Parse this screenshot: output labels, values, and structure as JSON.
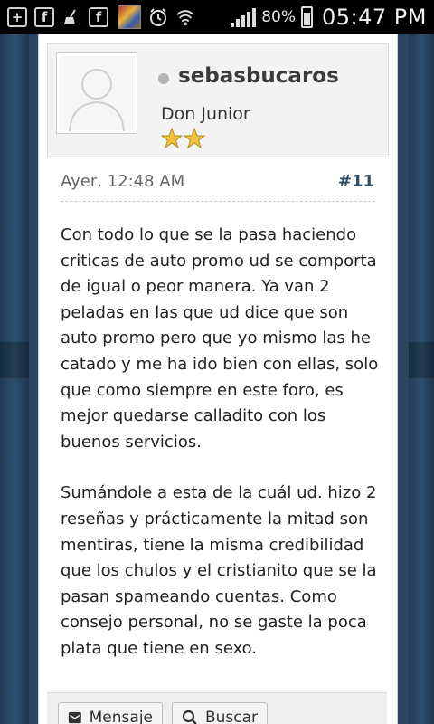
{
  "status_bar": {
    "left_icons": [
      "add-icon",
      "facebook-icon",
      "broom-icon",
      "facebook-icon",
      "app-thumbnail-icon",
      "alarm-icon",
      "wifi-icon",
      "signal-icon"
    ],
    "battery_percent": "80%",
    "time": "05:47 PM"
  },
  "post": {
    "author": {
      "username": "sebasbucaros",
      "title": "Don Junior",
      "online": false,
      "stars": 2
    },
    "date": "Ayer, 12:48 AM",
    "number": "#11",
    "paragraphs": [
      "Con todo lo que se la pasa haciendo criticas de auto promo ud se comporta de igual o peor manera. Ya van 2 peladas en las que ud dice que son auto promo pero que yo mismo las he catado y me ha ido bien con ellas, solo que como siempre en este foro, es mejor quedarse calladito con los buenos servicios.",
      "Sumándole a esta de la cuál ud. hizo 2 reseñas y prácticamente la mitad son mentiras, tiene la misma credibilidad que los chulos y el cristianito que se la pasan spameando cuentas. Como consejo personal, no se gaste la poca plata que tiene en sexo."
    ],
    "actions": {
      "message_label": "Mensaje",
      "search_label": "Buscar"
    }
  },
  "colors": {
    "background": "#2a4663",
    "post_number": "#2f4a63",
    "star": "#f2c33a"
  }
}
